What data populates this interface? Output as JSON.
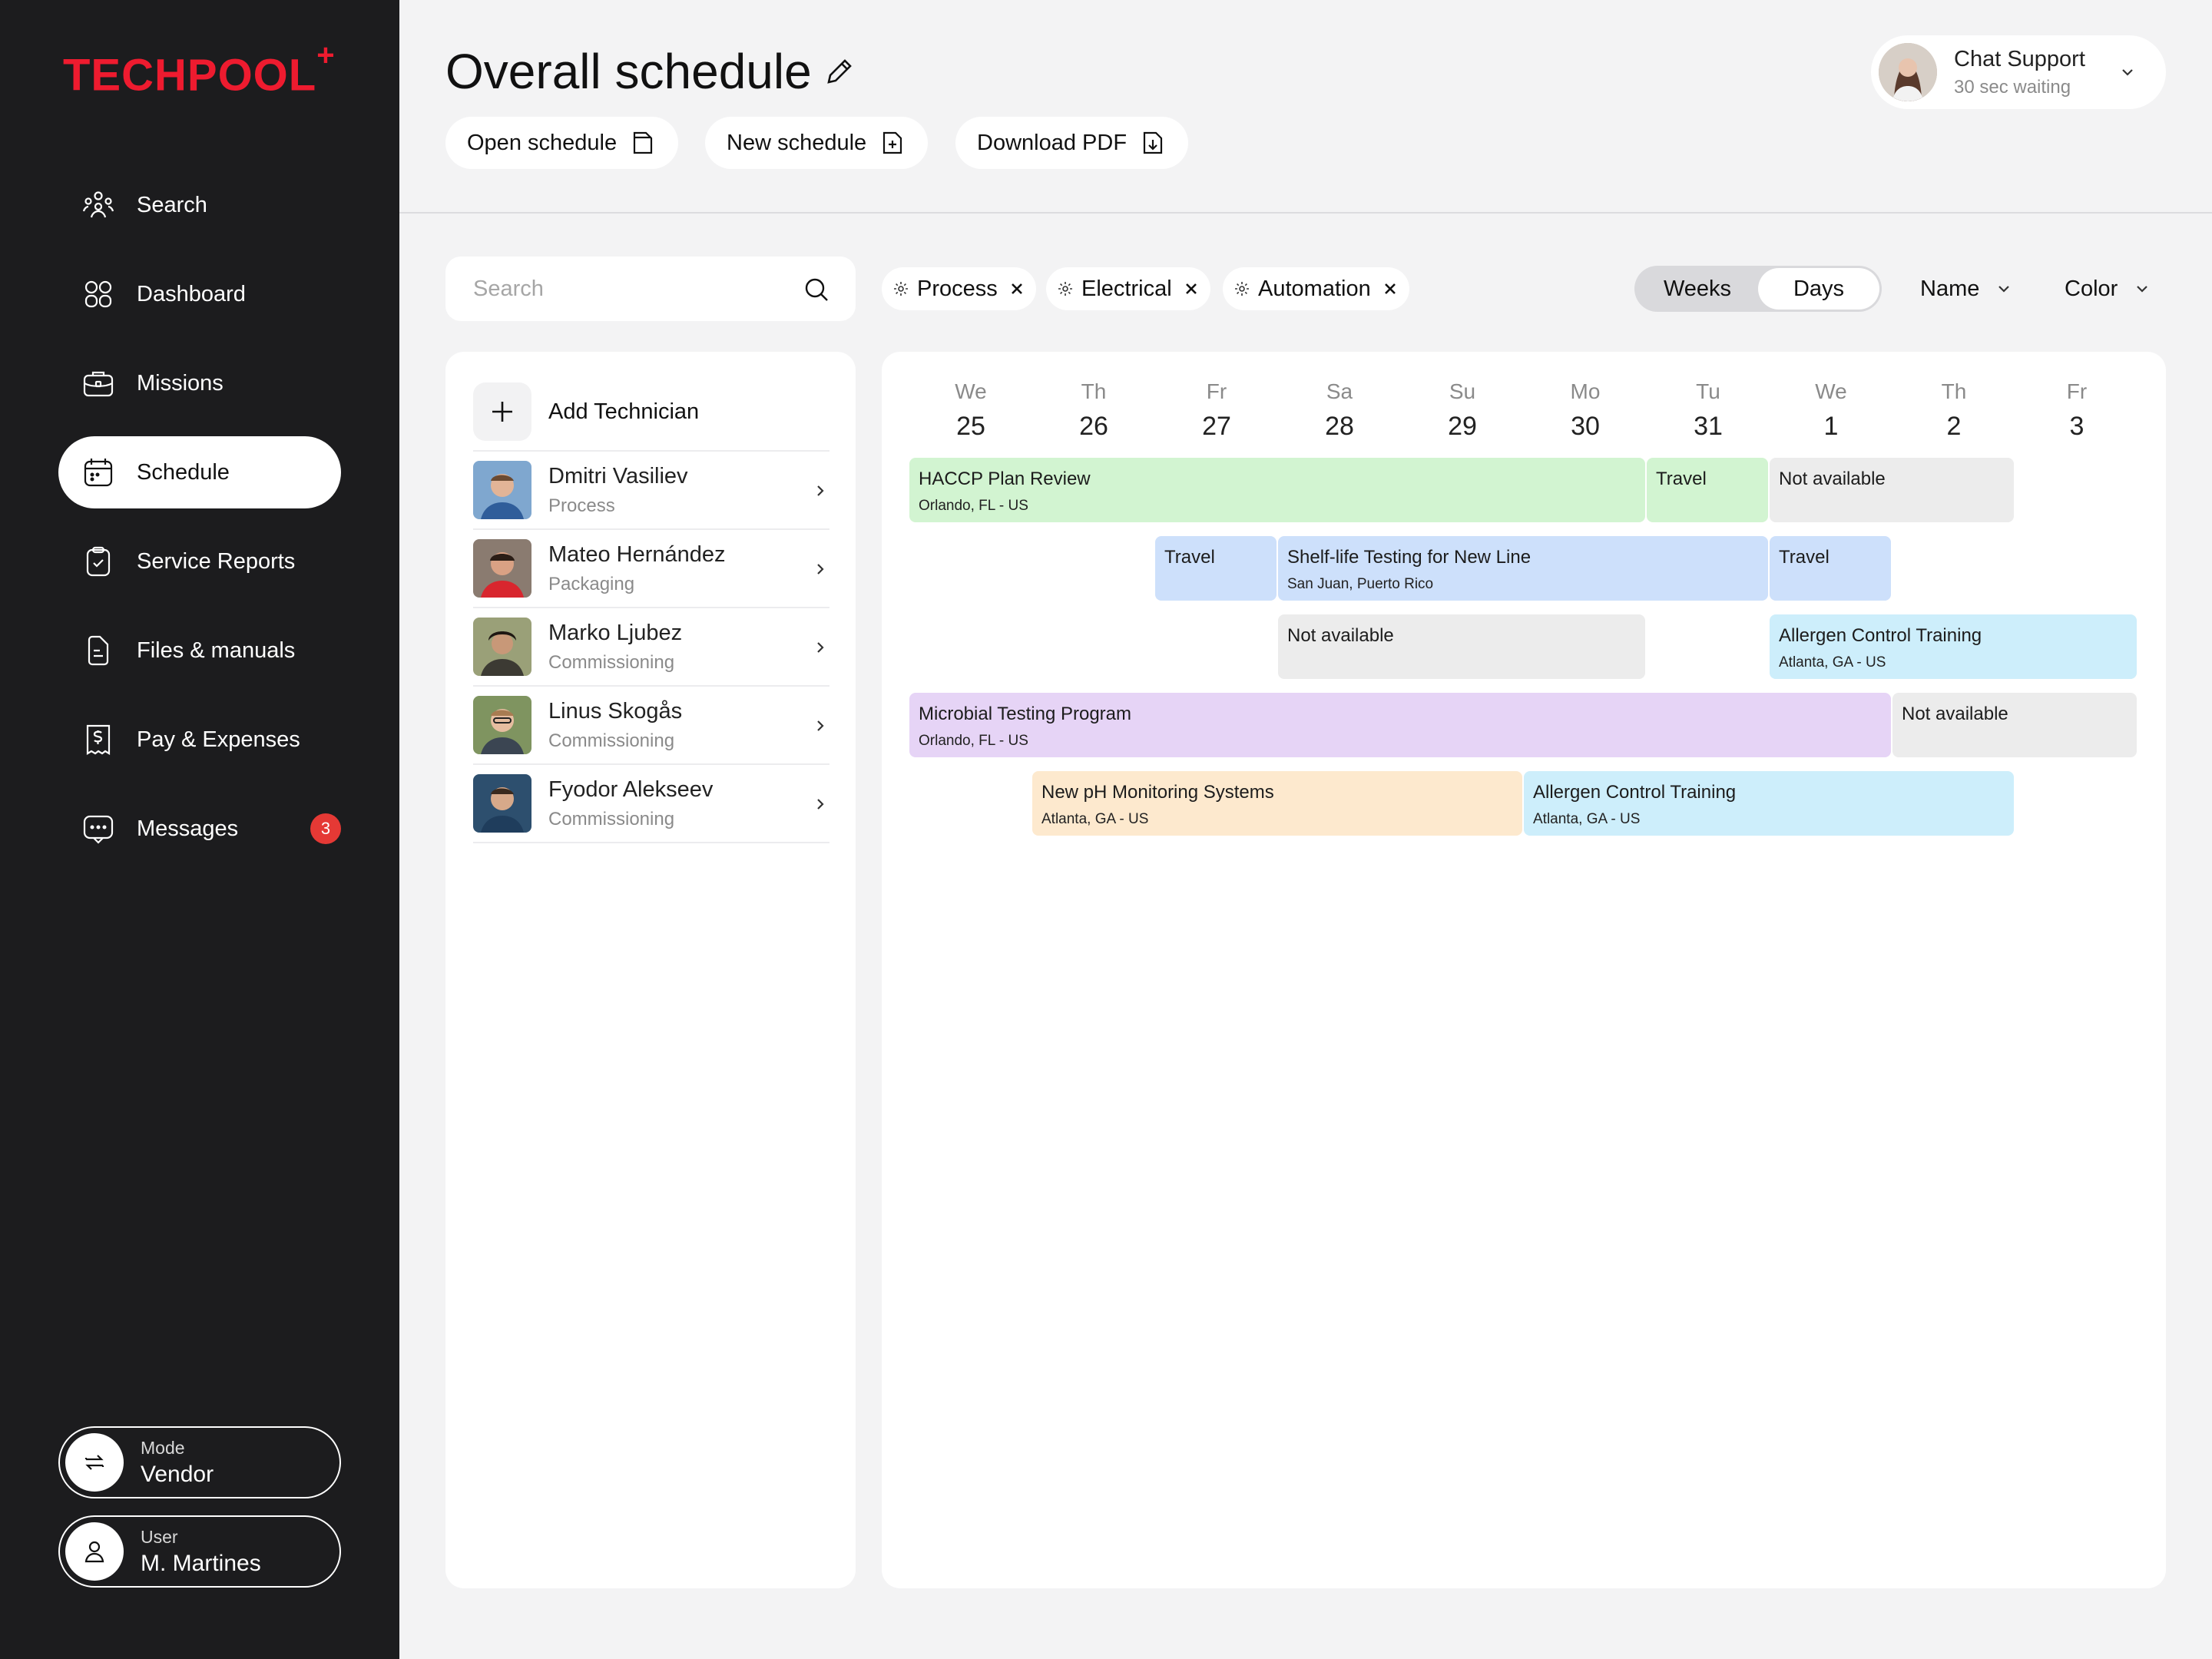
{
  "brand": {
    "name": "TECHPOOL",
    "mark": "+",
    "color": "#ee1b2f"
  },
  "sidebar": {
    "items": [
      {
        "label": "Search",
        "icon": "people-search-icon"
      },
      {
        "label": "Dashboard",
        "icon": "grid-icon"
      },
      {
        "label": "Missions",
        "icon": "toolbox-icon"
      },
      {
        "label": "Schedule",
        "icon": "calendar-icon",
        "active": true
      },
      {
        "label": "Service Reports",
        "icon": "clipboard-check-icon"
      },
      {
        "label": "Files & manuals",
        "icon": "document-icon"
      },
      {
        "label": "Pay & Expenses",
        "icon": "receipt-dollar-icon"
      },
      {
        "label": "Messages",
        "icon": "chat-bubble-icon",
        "badge": "3"
      }
    ],
    "mode": {
      "label": "Mode",
      "value": "Vendor"
    },
    "user": {
      "label": "User",
      "value": "M. Martines"
    }
  },
  "header": {
    "title": "Overall schedule",
    "buttons": {
      "open": "Open schedule",
      "new": "New schedule",
      "download": "Download PDF"
    },
    "chat": {
      "title": "Chat Support",
      "status": "30 sec waiting"
    }
  },
  "toolbar": {
    "search_placeholder": "Search",
    "chips": [
      "Process",
      "Electrical",
      "Automation"
    ],
    "view_options": [
      "Weeks",
      "Days"
    ],
    "view_selected": "Days",
    "sort": "Name",
    "color": "Color"
  },
  "technicians": {
    "add_label": "Add Technician",
    "list": [
      {
        "name": "Dmitri Vasiliev",
        "role": "Process"
      },
      {
        "name": "Mateo Hernández",
        "role": "Packaging"
      },
      {
        "name": "Marko Ljubez",
        "role": "Commissioning"
      },
      {
        "name": "Linus Skogås",
        "role": "Commissioning"
      },
      {
        "name": "Fyodor Alekseev",
        "role": "Commissioning"
      }
    ]
  },
  "calendar": {
    "days": [
      {
        "dow": "We",
        "date": "25"
      },
      {
        "dow": "Th",
        "date": "26"
      },
      {
        "dow": "Fr",
        "date": "27"
      },
      {
        "dow": "Sa",
        "date": "28"
      },
      {
        "dow": "Su",
        "date": "29"
      },
      {
        "dow": "Mo",
        "date": "30"
      },
      {
        "dow": "Tu",
        "date": "31"
      },
      {
        "dow": "We",
        "date": "1"
      },
      {
        "dow": "Th",
        "date": "2"
      },
      {
        "dow": "Fr",
        "date": "3"
      }
    ],
    "rows": [
      [
        {
          "title": "HACCP Plan Review",
          "location": "Orlando, FL - US",
          "color": "green"
        },
        {
          "title": "Travel",
          "color": "green"
        },
        {
          "title": "Not available",
          "color": "gray"
        }
      ],
      [
        {
          "title": "Travel",
          "color": "blue"
        },
        {
          "title": "Shelf-life Testing for New Line",
          "location": "San Juan, Puerto Rico",
          "color": "blue"
        },
        {
          "title": "Travel",
          "color": "blue"
        }
      ],
      [
        {
          "title": "Not available",
          "color": "gray"
        },
        {
          "title": "Allergen Control Training",
          "location": "Atlanta, GA - US",
          "color": "cyan"
        }
      ],
      [
        {
          "title": "Microbial Testing Program",
          "location": "Orlando, FL - US",
          "color": "purple"
        },
        {
          "title": "Not available",
          "color": "gray"
        }
      ],
      [
        {
          "title": "New pH Monitoring Systems",
          "location": "Atlanta, GA - US",
          "color": "peach"
        },
        {
          "title": "Allergen Control Training",
          "location": "Atlanta, GA - US",
          "color": "cyan"
        }
      ]
    ]
  }
}
